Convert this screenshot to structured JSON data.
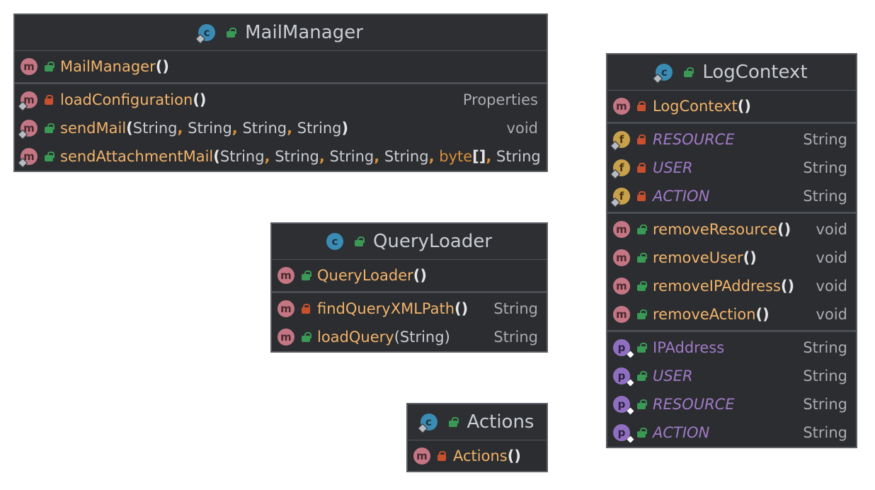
{
  "classes": {
    "mail": {
      "name": "MailManager",
      "constructor": "MailManager",
      "methods": [
        {
          "name": "loadConfiguration",
          "params": "()",
          "type": "Properties"
        },
        {
          "name": "sendMail",
          "params": "(String, String, String, String)",
          "type": "void"
        },
        {
          "name": "sendAttachmentMail",
          "params": "(String, String, String, String, byte[], String",
          "type": ""
        }
      ]
    },
    "query": {
      "name": "QueryLoader",
      "constructor": "QueryLoader",
      "methods": [
        {
          "name": "findQueryXMLPath",
          "params": "()",
          "type": "String"
        },
        {
          "name": "loadQuery",
          "params": "(String)",
          "type": "String"
        }
      ]
    },
    "actions": {
      "name": "Actions",
      "constructor": "Actions"
    },
    "log": {
      "name": "LogContext",
      "constructor": "LogContext",
      "fields": [
        {
          "name": "RESOURCE",
          "type": "String"
        },
        {
          "name": "USER",
          "type": "String"
        },
        {
          "name": "ACTION",
          "type": "String"
        }
      ],
      "methods": [
        {
          "name": "removeResource",
          "params": "()",
          "type": "void"
        },
        {
          "name": "removeUser",
          "params": "()",
          "type": "void"
        },
        {
          "name": "removeIPAddress",
          "params": "()",
          "type": "void"
        },
        {
          "name": "removeAction",
          "params": "()",
          "type": "void"
        }
      ],
      "properties": [
        {
          "name": "IPAddress",
          "type": "String"
        },
        {
          "name": "USER",
          "type": "String"
        },
        {
          "name": "RESOURCE",
          "type": "String"
        },
        {
          "name": "ACTION",
          "type": "String"
        }
      ]
    }
  },
  "badges": {
    "class": "c",
    "method": "m",
    "field": "f",
    "property": "p"
  },
  "colors": {
    "background": "#2b2d30",
    "method": "#f2b36b",
    "keyword": "#d98f3a",
    "lock_open": "#3a9a55",
    "lock_closed": "#c9502e"
  },
  "icons": [
    "class-icon",
    "method-icon",
    "field-icon",
    "property-icon",
    "public-lock-icon",
    "private-lock-icon"
  ]
}
